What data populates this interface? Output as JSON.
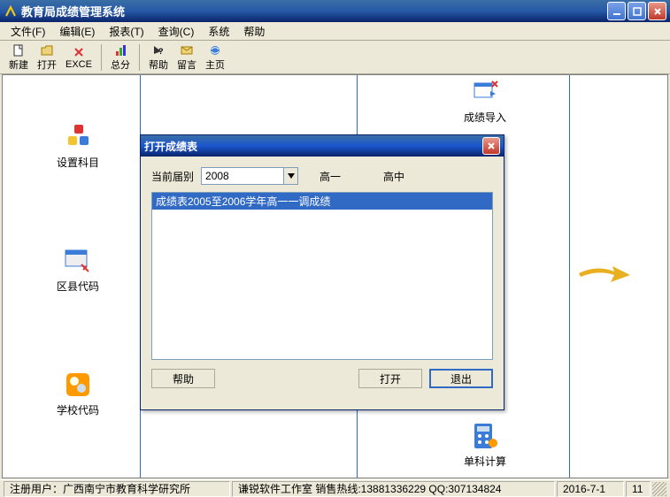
{
  "window": {
    "title": "教育局成绩管理系统"
  },
  "menu": {
    "file": "文件(F)",
    "edit": "编辑(E)",
    "report": "报表(T)",
    "query": "查询(C)",
    "system": "系统",
    "help": "帮助"
  },
  "toolbar": {
    "new": "新建",
    "open": "打开",
    "exce": "EXCE",
    "total": "总分",
    "help": "帮助",
    "msg": "留言",
    "home": "主页"
  },
  "desktop": {
    "subject": "设置科目",
    "district": "区县代码",
    "school": "学校代码",
    "import": "成绩导入",
    "single": "单科计算"
  },
  "dialog": {
    "title": "打开成绩表",
    "current_label": "当前届别",
    "year": "2008",
    "grade1": "高一",
    "high": "高中",
    "items": [
      "成绩表2005至2006学年高一一调成绩"
    ],
    "btn_help": "帮助",
    "btn_open": "打开",
    "btn_exit": "退出"
  },
  "status": {
    "user_label": "注册用户：",
    "user": "广西南宁市教育科学研究所",
    "vendor": "谦锐软件工作室 销售热线:13881336229 QQ:307134824",
    "date": "2016-7-1",
    "extra": "11"
  }
}
